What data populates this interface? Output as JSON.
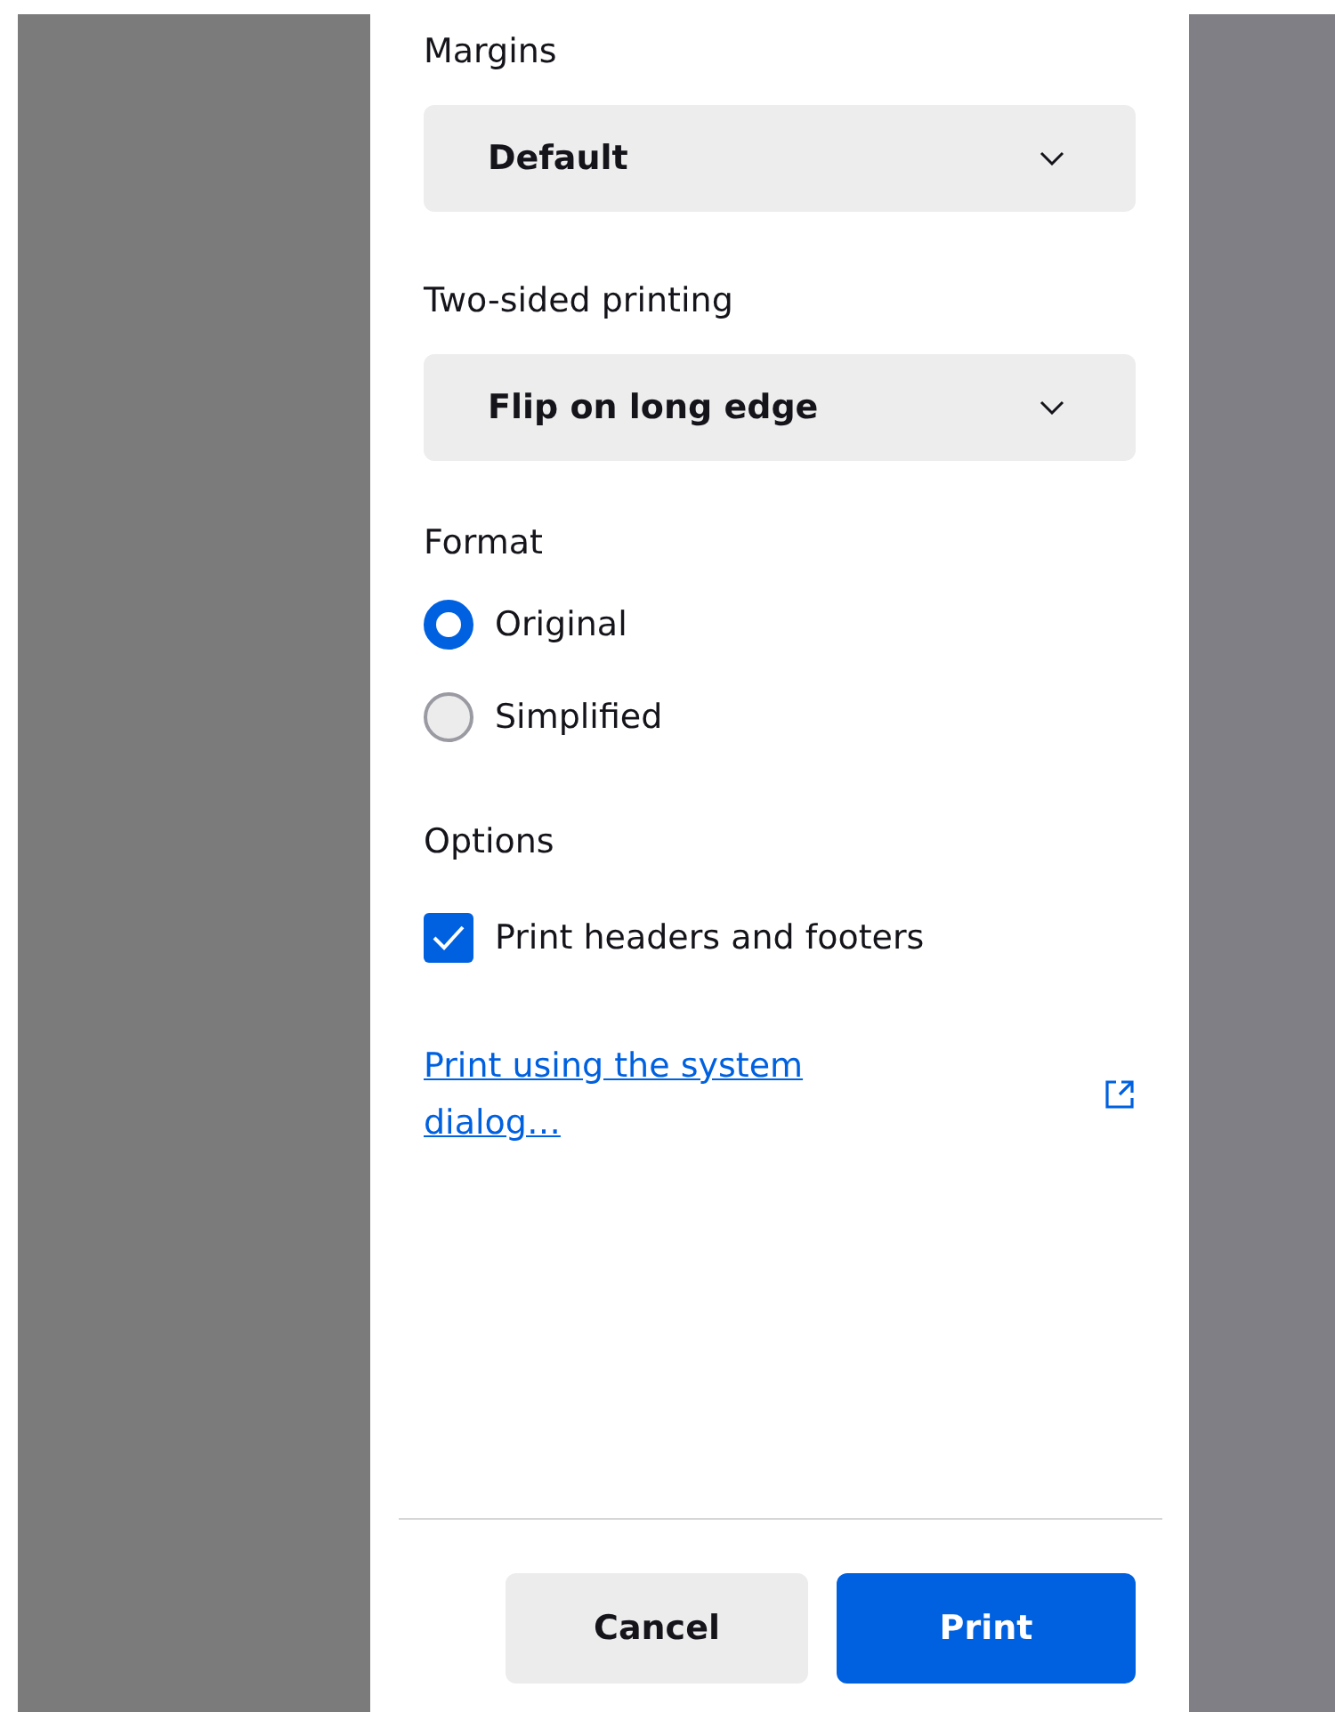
{
  "margins": {
    "label": "Margins",
    "value": "Default"
  },
  "two_sided": {
    "label": "Two-sided printing",
    "value": "Flip on long edge"
  },
  "format": {
    "label": "Format",
    "options": [
      {
        "label": "Original",
        "selected": true
      },
      {
        "label": "Simplified",
        "selected": false
      }
    ]
  },
  "options": {
    "label": "Options",
    "items": [
      {
        "label": "Print headers and footers",
        "checked": true
      }
    ]
  },
  "system_dialog_link": "Print using the system dialog…",
  "buttons": [
    {
      "label": "Cancel",
      "kind": "secondary"
    },
    {
      "label": "Print",
      "kind": "primary"
    }
  ]
}
